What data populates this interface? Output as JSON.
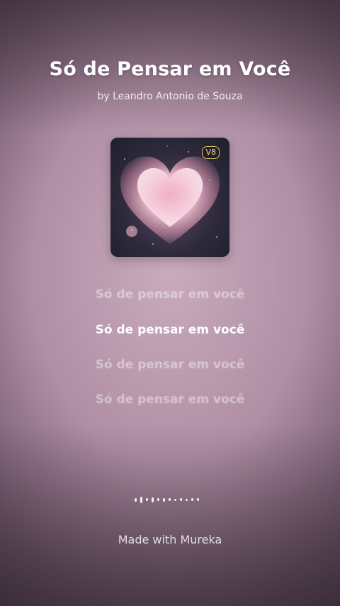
{
  "song": {
    "title": "Só de Pensar em Você",
    "artist": "by Leandro Antonio de Souza",
    "badge": "V8"
  },
  "lyrics": [
    "Só de pensar em você",
    "Só de pensar em você",
    "Só de pensar em você",
    "Só de pensar em você"
  ],
  "active_lyric_index": 1,
  "footer": "Made with Mureka",
  "cover_icon": "pink-heart-artwork",
  "colors": {
    "badge": "#d8bf6a",
    "heart": "#f4b8cc"
  }
}
